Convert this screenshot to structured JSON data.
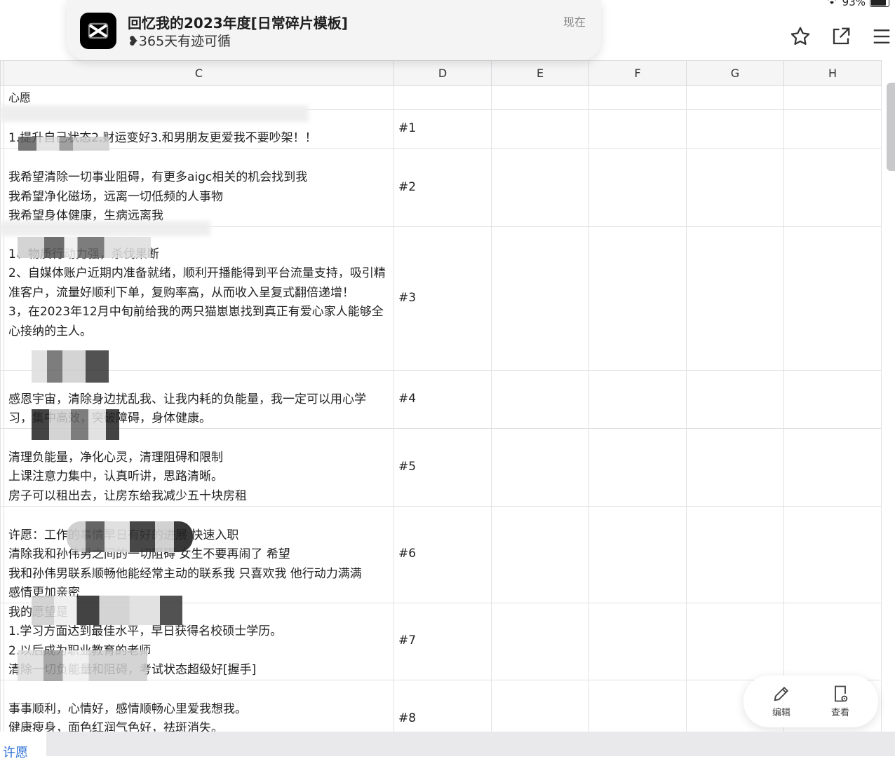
{
  "status_bar": {
    "battery_text": "93%"
  },
  "notification": {
    "title": "回忆我的2023年度[日常碎片模板]",
    "subtitle": "❥365天有迹可循",
    "time": "现在",
    "app_icon": "capcut-icon"
  },
  "toolbar": {
    "icons": [
      "star-icon",
      "share-icon",
      "menu-icon"
    ]
  },
  "columns": [
    "",
    "C",
    "D",
    "E",
    "F",
    "G",
    "H",
    ""
  ],
  "rows": [
    {
      "c": "心愿",
      "d": ""
    },
    {
      "c": "1.提升自己状态2.财运变好3.和男朋友更爱我不要吵架！！",
      "d": "#1"
    },
    {
      "c": "我希望清除一切事业阻碍，有更多aigc相关的机会找到我\n我希望净化磁场，远离一切低频的人事物\n我希望身体健康，生病远离我",
      "d": "#2"
    },
    {
      "c": "1、物质行动力强，杀伐果断\n2、自媒体账户近期内准备就绪，顺利开播能得到平台流量支持，吸引精准客户，流量好顺利下单，复购率高，从而收入呈复式翻倍递增！\n3，在2023年12月中旬前给我的两只猫崽崽找到真正有爱心家人能够全心接纳的主人。",
      "d": "#3"
    },
    {
      "c": "感恩宇宙，清除身边扰乱我、让我内耗的负能量，我一定可以用心学习，集中高效，突破障碍，身体健康。",
      "d": "#4"
    },
    {
      "c": "清理负能量，净化心灵，清理阻碍和限制\n上课注意力集中，认真听讲，思路清晰。\n房子可以租出去，让房东给我减少五十块房租",
      "d": "#5"
    },
    {
      "c": "许愿：工作的事情早日有好的进展 快速入职\n清除我和孙伟男之间的一切阻碍 女生不要再闹了 希望\n我和孙伟男联系顺畅他能经常主动的联系我 只喜欢我 他行动力满满\n感情更加亲密",
      "d": "#6"
    },
    {
      "c": "我的愿望是\n1.学习方面达到最佳水平，早日获得名校硕士学历。\n2.以后成为职业教育的老师\n清除一切负能量和阻碍，考试状态超级好[握手]",
      "d": "#7"
    },
    {
      "c": "事事顺利，心情好，感情顺畅心里爱我想我。\n健康瘦身，面色红润气色好，祛斑消失。\n主管药师，执业药师都过",
      "d": "#8"
    }
  ],
  "float_actions": [
    {
      "label": "编辑",
      "icon": "pencil-icon"
    },
    {
      "label": "查看",
      "icon": "view-doc-icon"
    }
  ],
  "bottom_tab": "许愿"
}
